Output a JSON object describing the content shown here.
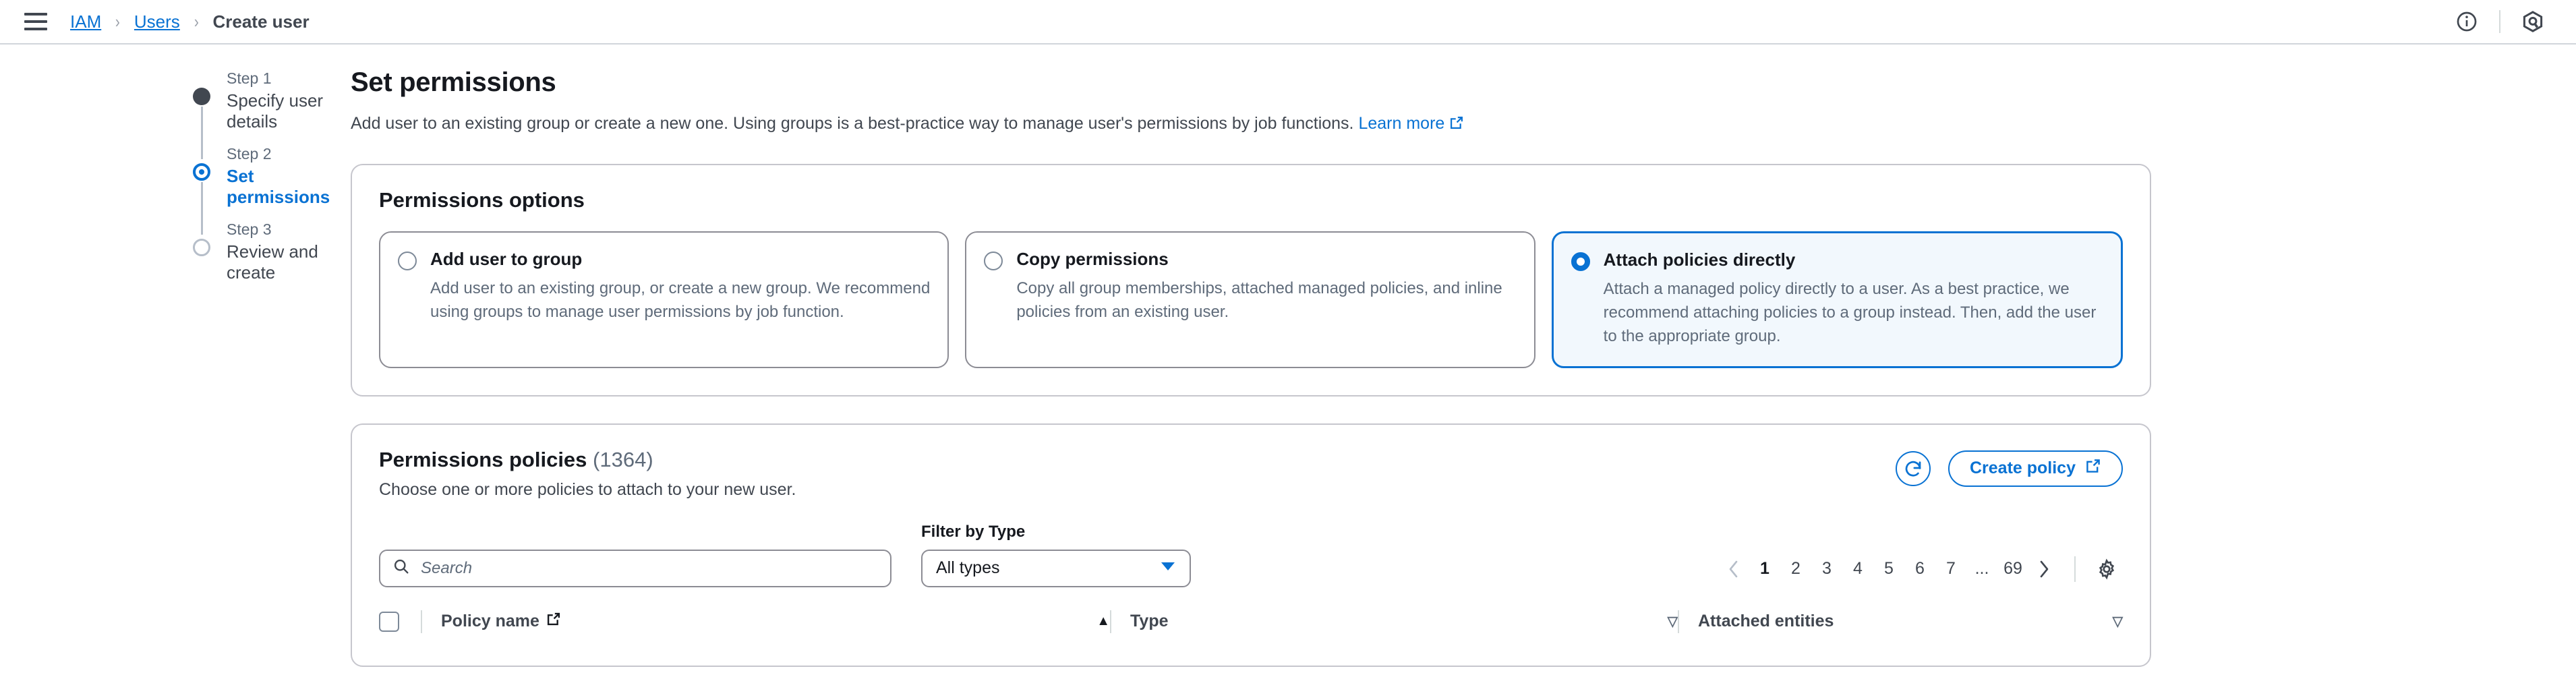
{
  "topbar": {
    "menu_icon": "hamburger-menu-icon",
    "breadcrumb": [
      {
        "label": "IAM",
        "type": "link"
      },
      {
        "label": "Users",
        "type": "link"
      },
      {
        "label": "Create user",
        "type": "current"
      }
    ],
    "separator": "›",
    "info_icon": "info-circle-icon",
    "q_icon": "amazon-q-icon"
  },
  "stepper": {
    "steps": [
      {
        "num": "Step 1",
        "title": "Specify user details",
        "state": "done"
      },
      {
        "num": "Step 2",
        "title": "Set permissions",
        "state": "active"
      },
      {
        "num": "Step 3",
        "title": "Review and create",
        "state": "todo"
      }
    ]
  },
  "header": {
    "title": "Set permissions",
    "description": "Add user to an existing group or create a new one. Using groups is a best-practice way to manage user's permissions by job functions.",
    "learn_more": "Learn more",
    "external_icon": "external-link-icon"
  },
  "permissions_options": {
    "title": "Permissions options",
    "cards": [
      {
        "label": "Add user to group",
        "description": "Add user to an existing group, or create a new group. We recommend using groups to manage user permissions by job function.",
        "selected": false
      },
      {
        "label": "Copy permissions",
        "description": "Copy all group memberships, attached managed policies, and inline policies from an existing user.",
        "selected": false
      },
      {
        "label": "Attach policies directly",
        "description": "Attach a managed policy directly to a user. As a best practice, we recommend attaching policies to a group instead. Then, add the user to the appropriate group.",
        "selected": true
      }
    ]
  },
  "permissions_policies": {
    "title": "Permissions policies",
    "count": "(1364)",
    "subtitle": "Choose one or more policies to attach to your new user.",
    "refresh_icon": "refresh-icon",
    "create_policy_label": "Create policy",
    "create_policy_icon": "external-link-icon",
    "search": {
      "icon": "search-icon",
      "placeholder": "Search",
      "value": ""
    },
    "filter": {
      "label": "Filter by Type",
      "selected": "All types",
      "caret_icon": "chevron-down-icon"
    },
    "pagination": {
      "prev_icon": "chevron-left-icon",
      "next_icon": "chevron-right-icon",
      "pages": [
        "1",
        "2",
        "3",
        "4",
        "5",
        "6",
        "7",
        "...",
        "69"
      ],
      "current": "1",
      "settings_icon": "gear-icon"
    },
    "table": {
      "select_all_checkbox": "select-all-checkbox",
      "columns": [
        {
          "label": "Policy name",
          "has_external_icon": true,
          "sort": "asc"
        },
        {
          "label": "Type",
          "has_external_icon": false,
          "sort": "none"
        },
        {
          "label": "Attached entities",
          "has_external_icon": false,
          "sort": "none"
        }
      ],
      "sort_asc_glyph": "▲",
      "sort_idle_glyph": "▽"
    }
  },
  "colors": {
    "link": "#0972d3",
    "text": "#16191f",
    "muted": "#5f6b7a",
    "border": "#8c8c94",
    "selected_bg": "#f2f8fd"
  }
}
